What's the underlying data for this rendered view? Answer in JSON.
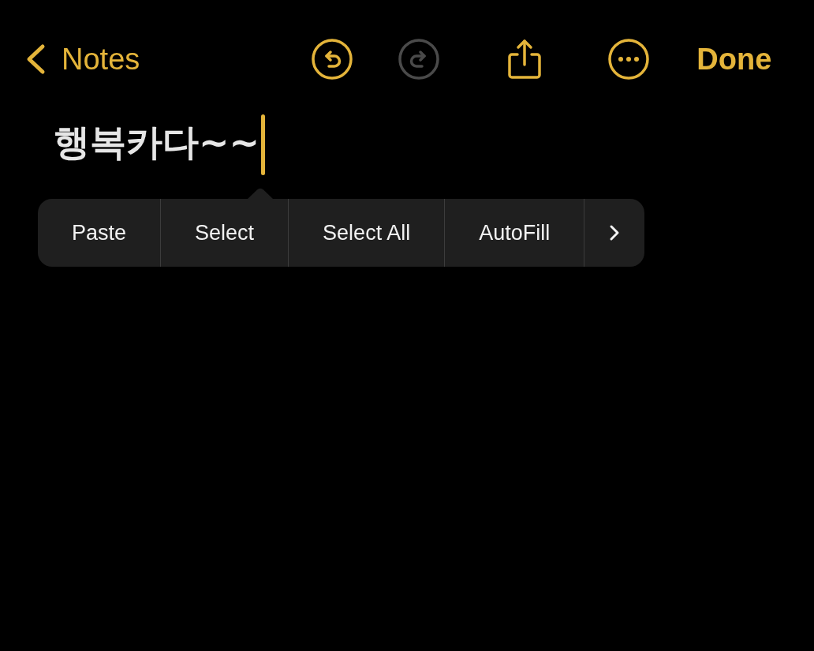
{
  "toolbar": {
    "back": {
      "label": "Notes"
    },
    "undo": {
      "disabled": false
    },
    "redo": {
      "disabled": true
    },
    "done": {
      "label": "Done"
    }
  },
  "note": {
    "title": "행복카다~~",
    "cursor": true
  },
  "edit_menu": {
    "items": [
      {
        "kind": "text",
        "label": "Paste"
      },
      {
        "kind": "text",
        "label": "Select"
      },
      {
        "kind": "text",
        "label": "Select All"
      },
      {
        "kind": "text",
        "label": "AutoFill"
      },
      {
        "kind": "more"
      }
    ]
  }
}
